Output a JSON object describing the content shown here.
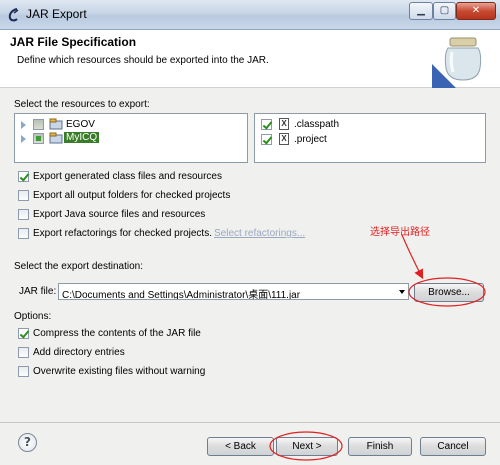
{
  "window": {
    "title": "JAR Export"
  },
  "header": {
    "title": "JAR File Specification",
    "description": "Define which resources should be exported into the JAR."
  },
  "resources": {
    "label": "Select the resources to export:",
    "tree": [
      {
        "label": "EGOV",
        "checked": false
      },
      {
        "label": "MyICQ",
        "checked": "partial",
        "selected": true
      }
    ],
    "files": [
      {
        "label": ".classpath",
        "checked": true
      },
      {
        "label": ".project",
        "checked": true
      }
    ]
  },
  "options_top": [
    {
      "label": "Export generated class files and resources",
      "checked": true
    },
    {
      "label": "Export all output folders for checked projects",
      "checked": false
    },
    {
      "label": "Export Java source files and resources",
      "checked": false
    },
    {
      "label": "Export refactorings for checked projects.",
      "checked": false
    }
  ],
  "select_refactorings": "Select refactorings...",
  "destination": {
    "label": "Select the export destination:",
    "jar_label": "JAR file:",
    "jar_value": "C:\\Documents and Settings\\Administrator\\桌面\\111.jar",
    "browse": "Browse..."
  },
  "options": {
    "label": "Options:",
    "items": [
      {
        "label": "Compress the contents of the JAR file",
        "checked": true
      },
      {
        "label": "Add directory entries",
        "checked": false
      },
      {
        "label": "Overwrite existing files without warning",
        "checked": false
      }
    ]
  },
  "annotation": "选择导出路径",
  "footer": {
    "back": "< Back",
    "next": "Next >",
    "finish": "Finish",
    "cancel": "Cancel"
  },
  "colors": {
    "annotation": "#e02020",
    "selection": "#3a7d29"
  }
}
